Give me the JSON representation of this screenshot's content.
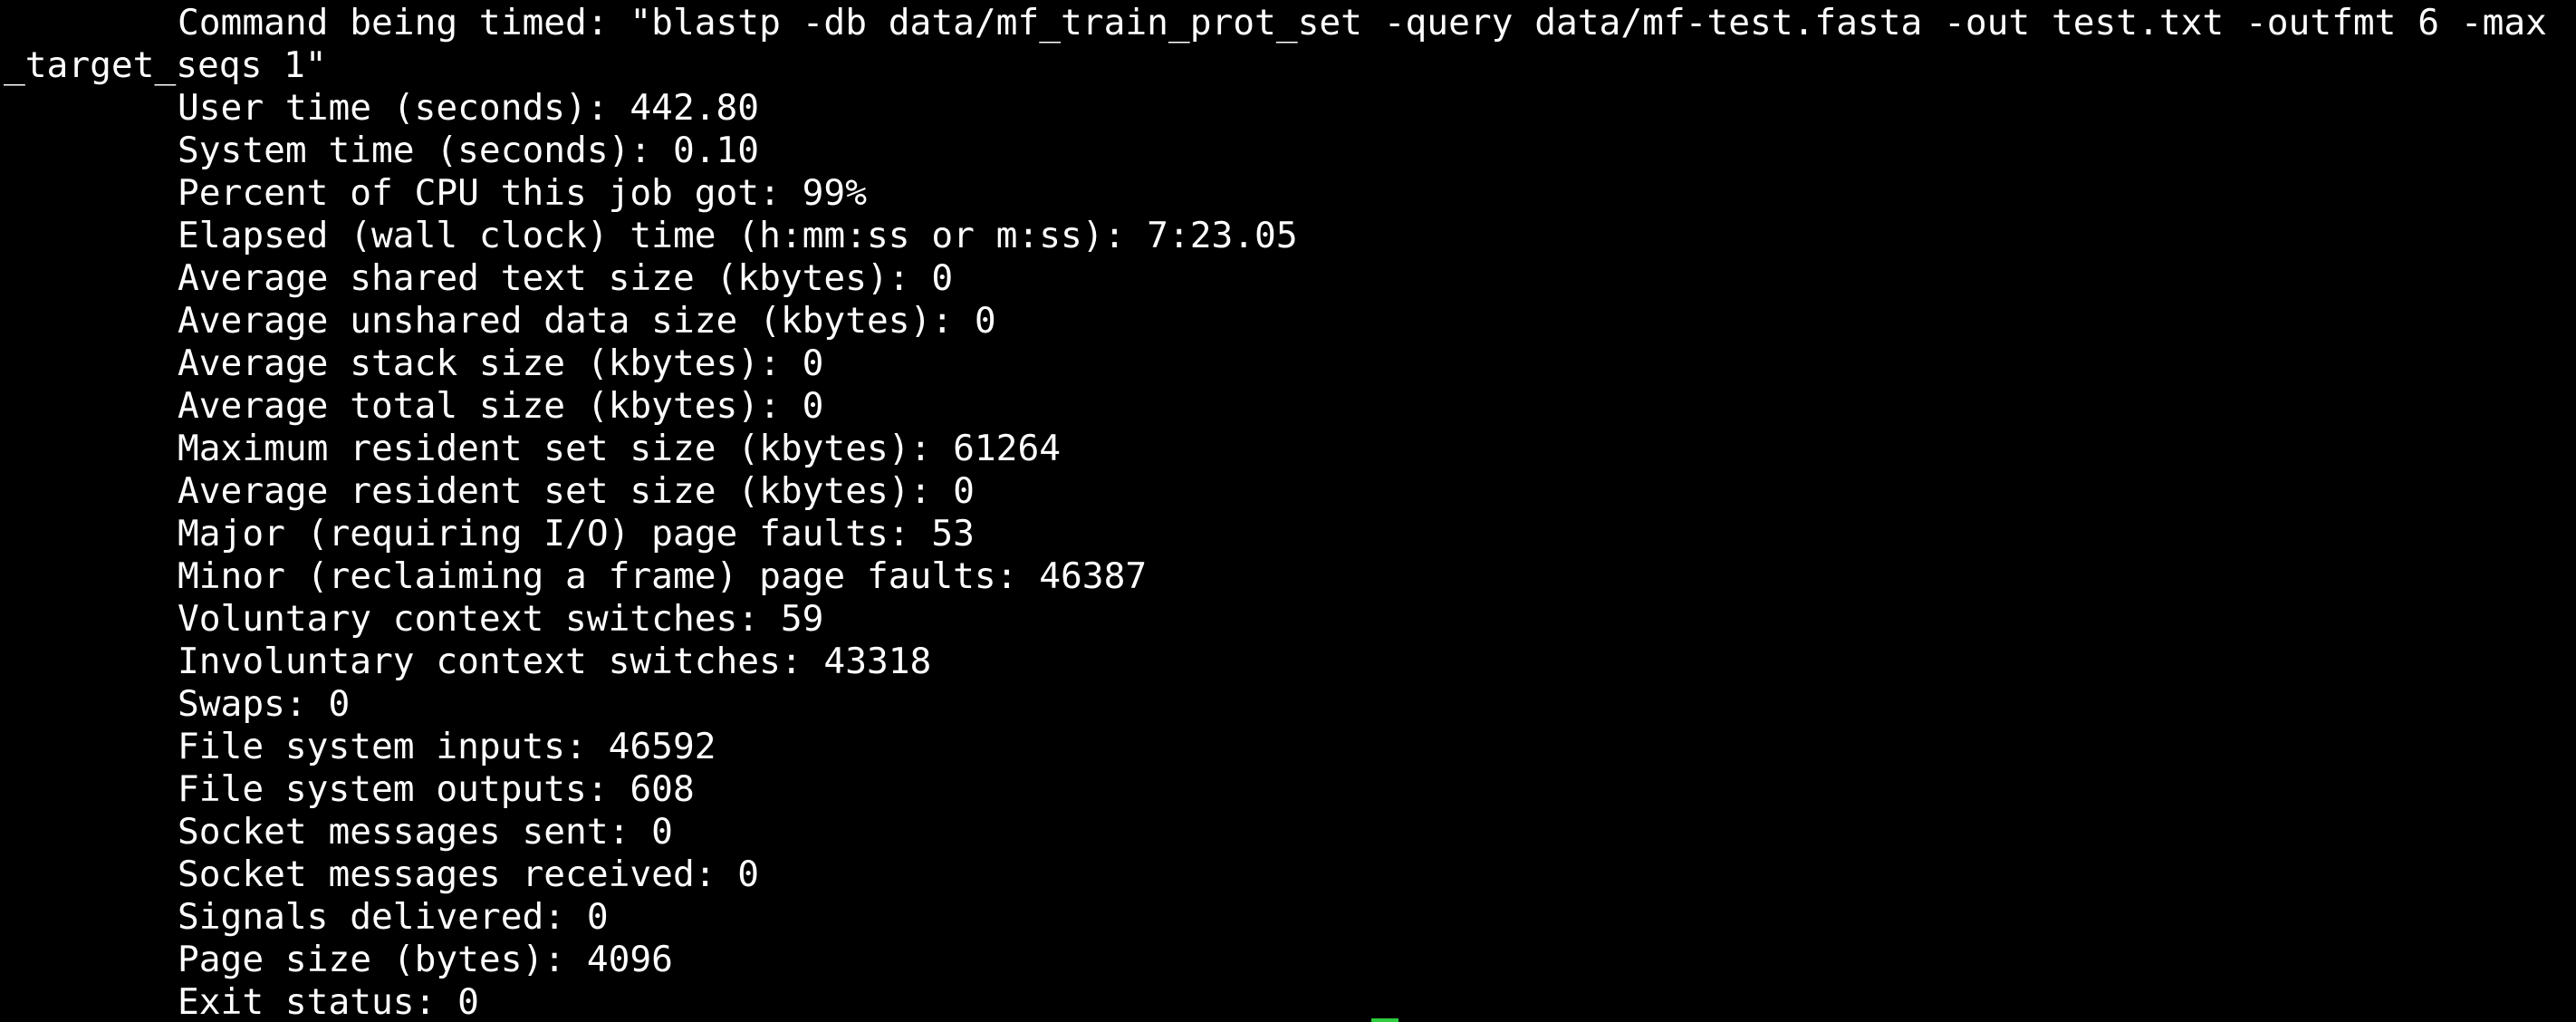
{
  "terminal": {
    "command_line": "Command being timed: \"blastp -db data/mf_train_prot_set -query data/mf-test.fasta -out test.txt -outfmt 6 -max",
    "command_wrap": "_target_seqs 1\"",
    "stats": [
      "User time (seconds): 442.80",
      "System time (seconds): 0.10",
      "Percent of CPU this job got: 99%",
      "Elapsed (wall clock) time (h:mm:ss or m:ss): 7:23.05",
      "Average shared text size (kbytes): 0",
      "Average unshared data size (kbytes): 0",
      "Average stack size (kbytes): 0",
      "Average total size (kbytes): 0",
      "Maximum resident set size (kbytes): 61264",
      "Average resident set size (kbytes): 0",
      "Major (requiring I/O) page faults: 53",
      "Minor (reclaiming a frame) page faults: 46387",
      "Voluntary context switches: 59",
      "Involuntary context switches: 43318",
      "Swaps: 0",
      "File system inputs: 46592",
      "File system outputs: 608",
      "Socket messages sent: 0",
      "Socket messages received: 0",
      "Signals delivered: 0",
      "Page size (bytes): 4096",
      "Exit status: 0"
    ],
    "colors": {
      "background": "#000000",
      "text": "#ffffff",
      "cursor": "#2ecc40"
    }
  }
}
